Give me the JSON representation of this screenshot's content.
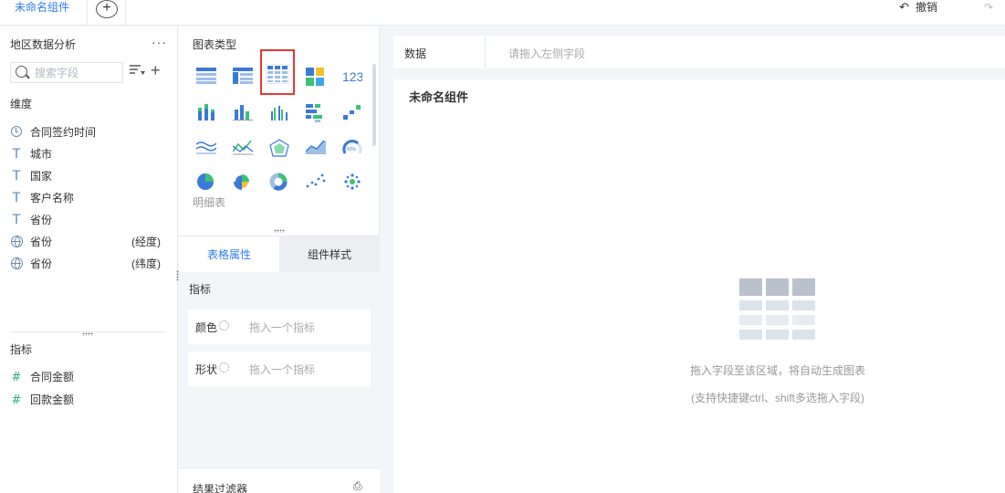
{
  "tabs": {
    "active_label": "未命名组件",
    "add_label": "+"
  },
  "toolbar": {
    "undo_label": "撤销",
    "redo_label": "重做"
  },
  "left_panel": {
    "title": "地区数据分析",
    "search_placeholder": "搜索字段",
    "dimension_label": "维度",
    "dimensions": [
      {
        "icon": "clock-icon",
        "label": "合同签约时间",
        "suffix": ""
      },
      {
        "icon": "text-type-icon",
        "label": "城市",
        "suffix": ""
      },
      {
        "icon": "text-type-icon",
        "label": "国家",
        "suffix": ""
      },
      {
        "icon": "text-type-icon",
        "label": "客户名称",
        "suffix": ""
      },
      {
        "icon": "text-type-icon",
        "label": "省份",
        "suffix": ""
      },
      {
        "icon": "globe-icon",
        "label": "省份",
        "suffix": "(经度)"
      },
      {
        "icon": "globe-icon",
        "label": "省份",
        "suffix": "(纬度)"
      }
    ],
    "measure_label": "指标",
    "measures": [
      {
        "icon": "number-type-icon",
        "label": "合同金额"
      },
      {
        "icon": "number-type-icon",
        "label": "回款金额"
      }
    ]
  },
  "middle_panel": {
    "title": "图表类型",
    "chart_types": [
      "table-chart-icon",
      "cross-table-icon",
      "detail-table-icon",
      "color-block-icon",
      "kpi-number-icon",
      "stacked-bar-icon",
      "bar-chart-icon",
      "grouped-bar-icon",
      "horizontal-bar-icon",
      "waterfall-icon",
      "line-chart-icon",
      "multi-line-icon",
      "radar-chart-icon",
      "area-chart-icon",
      "gauge-chart-icon",
      "pie-chart-icon",
      "rose-chart-icon",
      "donut-chart-icon",
      "scatter-chart-icon",
      "bubble-chart-icon"
    ],
    "selected_chart": "detail-table-icon",
    "hover_label": "明细表",
    "tab_table_props": "表格属性",
    "tab_component_style": "组件样式",
    "prop_section_title": "指标",
    "color_label": "颜色",
    "color_placeholder": "拖入一个指标",
    "shape_label": "形状",
    "shape_placeholder": "拖入一个指标",
    "filter_label": "结果过滤器"
  },
  "data_bar": {
    "label": "数据",
    "placeholder": "请拖入左侧字段"
  },
  "canvas": {
    "title": "未命名组件",
    "hint_line1": "拖入字段至该区域，将自动生成图表",
    "hint_line2": "(支持快捷键ctrl、shift多选拖入字段)"
  },
  "colors": {
    "accent": "#2f7cf6",
    "selection": "#e53935",
    "chart_blue": "#3a7bd5",
    "chart_green": "#3cc07a"
  }
}
